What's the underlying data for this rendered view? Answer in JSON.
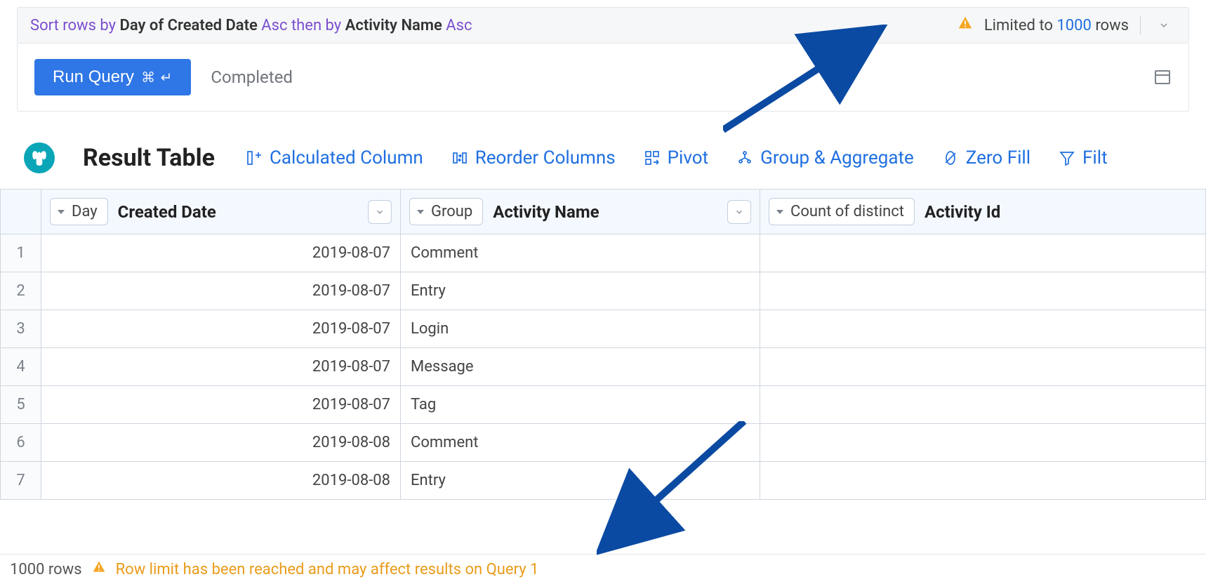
{
  "sort": {
    "prefix": "Sort rows by ",
    "field1": "Day of Created Date",
    "dir1": " Asc ",
    "then": "then by ",
    "field2": "Activity Name",
    "dir2": " Asc"
  },
  "limit": {
    "prefix": "Limited to ",
    "count": "1000",
    "suffix": " rows"
  },
  "run": {
    "label": "Run Query",
    "shortcut": "⌘ ↵",
    "status": "Completed"
  },
  "section": {
    "title": "Result Table"
  },
  "actions": {
    "calc": "Calculated Column",
    "reorder": "Reorder Columns",
    "pivot": "Pivot",
    "group": "Group & Aggregate",
    "zero": "Zero Fill",
    "filter": "Filt"
  },
  "columns": [
    {
      "pill": "Day",
      "label": "Created Date"
    },
    {
      "pill": "Group",
      "label": "Activity Name"
    },
    {
      "pill": "Count of distinct",
      "label": "Activity Id"
    }
  ],
  "rows": [
    {
      "n": "1",
      "date": "2019-08-07",
      "name": "Comment",
      "count": ""
    },
    {
      "n": "2",
      "date": "2019-08-07",
      "name": "Entry",
      "count": ""
    },
    {
      "n": "3",
      "date": "2019-08-07",
      "name": "Login",
      "count": ""
    },
    {
      "n": "4",
      "date": "2019-08-07",
      "name": "Message",
      "count": ""
    },
    {
      "n": "5",
      "date": "2019-08-07",
      "name": "Tag",
      "count": ""
    },
    {
      "n": "6",
      "date": "2019-08-08",
      "name": "Comment",
      "count": ""
    },
    {
      "n": "7",
      "date": "2019-08-08",
      "name": "Entry",
      "count": ""
    }
  ],
  "footer": {
    "rows": "1000 rows",
    "warning": "Row limit has been reached and may affect results on Query 1"
  }
}
